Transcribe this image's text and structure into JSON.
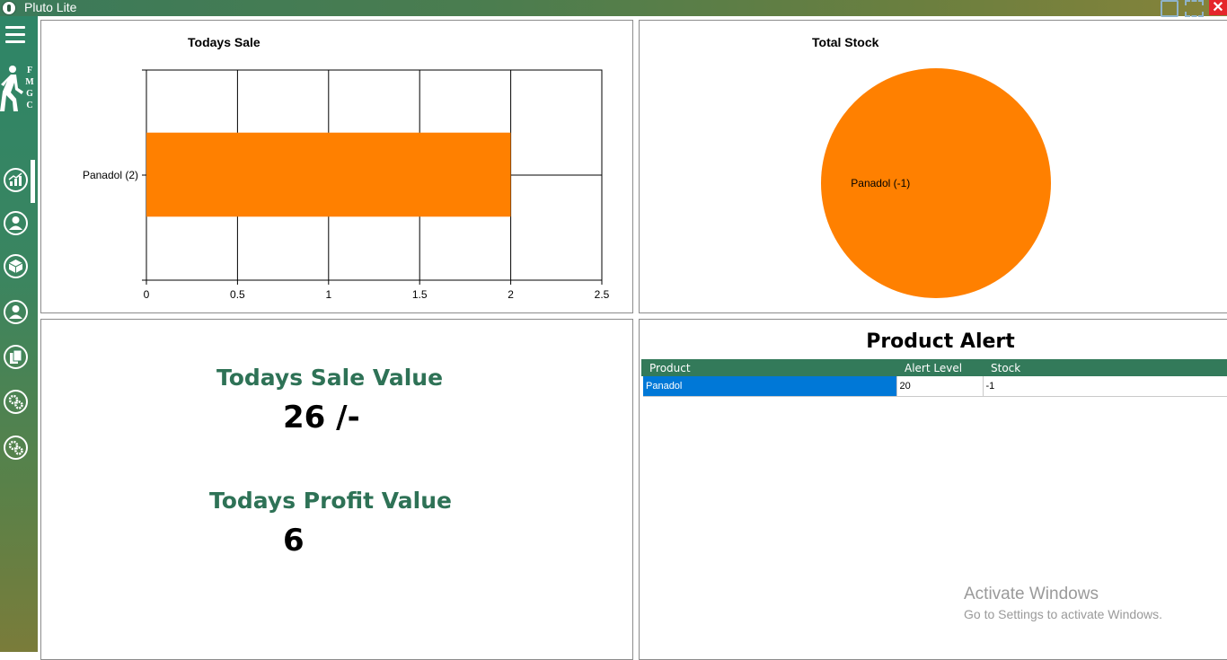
{
  "window": {
    "title": "Pluto Lite"
  },
  "sidebar": {
    "brand_letters": [
      "F",
      "M",
      "G",
      "C"
    ],
    "items": [
      {
        "name": "dashboard",
        "icon": "chart-growth-icon",
        "active": true
      },
      {
        "name": "customers",
        "icon": "user-icon"
      },
      {
        "name": "products",
        "icon": "box-icon"
      },
      {
        "name": "users",
        "icon": "person-icon"
      },
      {
        "name": "reports",
        "icon": "documents-icon"
      },
      {
        "name": "settings",
        "icon": "gears-icon"
      },
      {
        "name": "advanced-settings",
        "icon": "gears-icon"
      }
    ]
  },
  "sale_chart": {
    "title": "Todays Sale",
    "chart_data": {
      "type": "bar",
      "orientation": "horizontal",
      "title": "Todays Sale",
      "categories": [
        "Panadol (2)"
      ],
      "values": [
        2
      ],
      "xlim": [
        0,
        2.5
      ],
      "xticks": [
        "0",
        "0.5",
        "1",
        "1.5",
        "2",
        "2.5"
      ],
      "grid": true,
      "color": "#ff8000"
    }
  },
  "stock_chart": {
    "title": "Total Stock",
    "chart_data": {
      "type": "pie",
      "title": "Total Stock",
      "labels": [
        "Panadol (-1)"
      ],
      "values": [
        1
      ],
      "colors": [
        "#ff8000"
      ]
    }
  },
  "values": {
    "sale_label": "Todays Sale Value",
    "sale_value": "26 /-",
    "profit_label": "Todays Profit Value",
    "profit_value": "6"
  },
  "product_alert": {
    "title": "Product Alert",
    "columns": [
      "Product",
      "Alert Level",
      "Stock"
    ],
    "rows": [
      {
        "product": "Panadol",
        "alert_level": "20",
        "stock": "-1"
      }
    ]
  },
  "watermark": {
    "title": "Activate Windows",
    "subtitle": "Go to Settings to activate Windows."
  },
  "colors": {
    "accent_green": "#2e7256",
    "chart_orange": "#ff8000",
    "selection_blue": "#0078d7",
    "close_red": "#e5262b"
  }
}
